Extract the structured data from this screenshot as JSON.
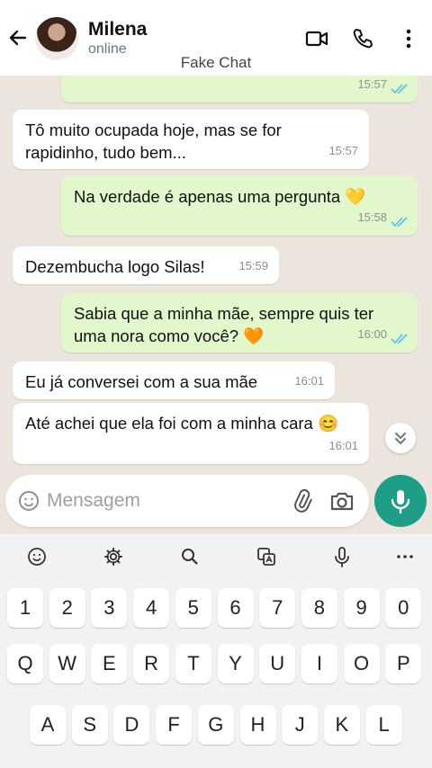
{
  "header": {
    "contact_name": "Milena",
    "status": "online",
    "watermark": "Fake Chat"
  },
  "messages": [
    {
      "dir": "out",
      "text": "",
      "time": "15:57",
      "read": true
    },
    {
      "dir": "in",
      "text": "Tô muito ocupada hoje, mas se for rapidinho, tudo bem...",
      "time": "15:57"
    },
    {
      "dir": "out",
      "text": "Na verdade é apenas uma pergunta 💛",
      "time": "15:58",
      "read": true
    },
    {
      "dir": "in",
      "text": "Dezembucha logo Silas!",
      "time": "15:59"
    },
    {
      "dir": "out",
      "text": "Sabia que a minha mãe, sempre quis ter uma nora como você? 🧡",
      "time": "16:00",
      "read": true
    },
    {
      "dir": "in",
      "text": "Eu já conversei com a sua mãe",
      "time": "16:01"
    },
    {
      "dir": "in",
      "text": "Até achei que ela foi com a minha cara 😊",
      "time": "16:01"
    }
  ],
  "composer": {
    "placeholder": "Mensagem"
  },
  "keyboard": {
    "row_numbers": [
      "1",
      "2",
      "3",
      "4",
      "5",
      "6",
      "7",
      "8",
      "9",
      "0"
    ],
    "row_top": [
      "Q",
      "W",
      "E",
      "R",
      "T",
      "Y",
      "U",
      "I",
      "O",
      "P"
    ],
    "row_middle": [
      "A",
      "S",
      "D",
      "F",
      "G",
      "H",
      "J",
      "K",
      "L"
    ],
    "toolbar_icons": [
      "emoji-icon",
      "settings-gear-icon",
      "search-icon",
      "translate-icon",
      "voice-input-icon",
      "more-icon"
    ]
  },
  "colors": {
    "outgoing_bubble": "#e2f7cb",
    "incoming_bubble": "#ffffff",
    "chat_background": "#ece5dd",
    "mic_button": "#1e9e87",
    "read_ticks": "#53bdeb"
  }
}
